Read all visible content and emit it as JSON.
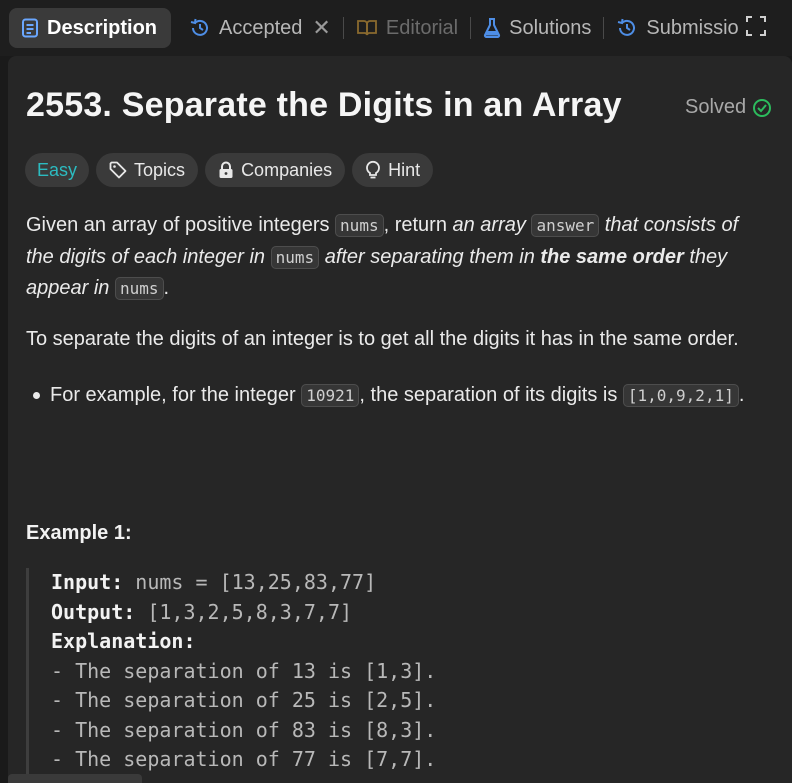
{
  "tabs": [
    {
      "label": "Description",
      "icon": "description-icon"
    },
    {
      "label": "Accepted",
      "icon": "history-icon"
    },
    {
      "label": "Editorial",
      "icon": "book-icon"
    },
    {
      "label": "Solutions",
      "icon": "flask-icon"
    },
    {
      "label": "Submissio",
      "icon": "history-icon"
    }
  ],
  "problem": {
    "title": "2553. Separate the Digits in an Array",
    "status": "Solved",
    "difficulty": "Easy",
    "chips": [
      "Topics",
      "Companies",
      "Hint"
    ]
  },
  "description": {
    "p1_a": "Given an array of positive integers ",
    "code_nums": "nums",
    "p1_b": ", return ",
    "p1_c": "an array ",
    "code_answer": "answer",
    "p1_d": " that consists of the digits of each integer in ",
    "p1_e": " after separating them in ",
    "p1_f": "the same order",
    "p1_g": " they appear in ",
    "p1_h": ".",
    "p2": "To separate the digits of an integer is to get all the digits it has in the same order.",
    "bullet_a": "For example, for the integer ",
    "code_10921": "10921",
    "bullet_b": ", the separation of its digits is ",
    "code_sep": "[1,0,9,2,1]",
    "bullet_c": "."
  },
  "example1": {
    "title": "Example 1:",
    "input_label": "Input:",
    "input_value": " nums = [13,25,83,77]",
    "output_label": "Output:",
    "output_value": " [1,3,2,5,8,3,7,7]",
    "explanation_label": "Explanation:",
    "lines": [
      "- The separation of 13 is [1,3].",
      "- The separation of 25 is [2,5].",
      "- The separation of 83 is [8,3].",
      "- The separation of 77 is [7,7]."
    ]
  },
  "colors": {
    "easy": "#2cbbc0",
    "solved_check": "#2cbb5d",
    "description_icon": "#6aa7ff",
    "accepted_icon": "#4e8ee6",
    "solutions_icon": "#4e8ee6"
  }
}
